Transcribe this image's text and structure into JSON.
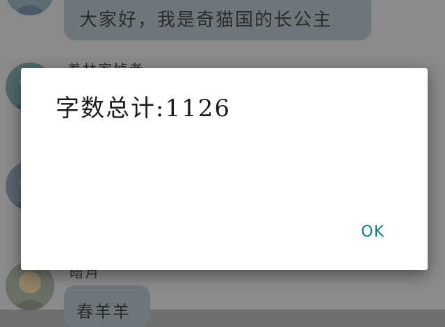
{
  "chat": {
    "messages": [
      {
        "text": "大家好，我是奇猫国的长公主"
      },
      {
        "sender": "着林家掉者"
      },
      {
        "sender": "暗月"
      },
      {
        "text": "春羊羊"
      }
    ]
  },
  "dialog": {
    "message": "字数总计:1126",
    "ok_label": "OK"
  },
  "colors": {
    "dialog_background": "#ffffff",
    "ok_text": "#137e7e",
    "overlay": "#8a8a8a"
  }
}
